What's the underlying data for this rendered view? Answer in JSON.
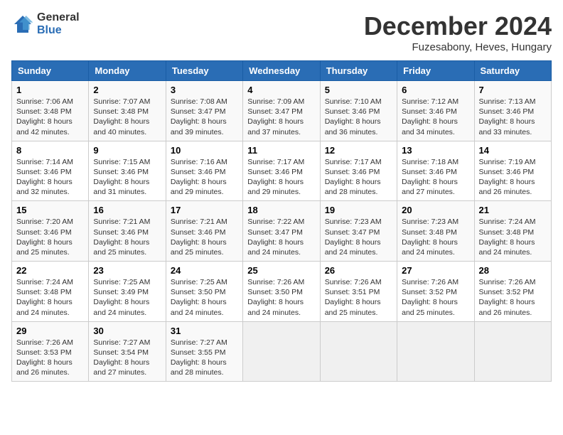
{
  "logo": {
    "general": "General",
    "blue": "Blue"
  },
  "title": "December 2024",
  "subtitle": "Fuzesabony, Heves, Hungary",
  "headers": [
    "Sunday",
    "Monday",
    "Tuesday",
    "Wednesday",
    "Thursday",
    "Friday",
    "Saturday"
  ],
  "weeks": [
    [
      {
        "day": "1",
        "sunrise": "7:06 AM",
        "sunset": "3:48 PM",
        "daylight": "8 hours and 42 minutes."
      },
      {
        "day": "2",
        "sunrise": "7:07 AM",
        "sunset": "3:48 PM",
        "daylight": "8 hours and 40 minutes."
      },
      {
        "day": "3",
        "sunrise": "7:08 AM",
        "sunset": "3:47 PM",
        "daylight": "8 hours and 39 minutes."
      },
      {
        "day": "4",
        "sunrise": "7:09 AM",
        "sunset": "3:47 PM",
        "daylight": "8 hours and 37 minutes."
      },
      {
        "day": "5",
        "sunrise": "7:10 AM",
        "sunset": "3:46 PM",
        "daylight": "8 hours and 36 minutes."
      },
      {
        "day": "6",
        "sunrise": "7:12 AM",
        "sunset": "3:46 PM",
        "daylight": "8 hours and 34 minutes."
      },
      {
        "day": "7",
        "sunrise": "7:13 AM",
        "sunset": "3:46 PM",
        "daylight": "8 hours and 33 minutes."
      }
    ],
    [
      {
        "day": "8",
        "sunrise": "7:14 AM",
        "sunset": "3:46 PM",
        "daylight": "8 hours and 32 minutes."
      },
      {
        "day": "9",
        "sunrise": "7:15 AM",
        "sunset": "3:46 PM",
        "daylight": "8 hours and 31 minutes."
      },
      {
        "day": "10",
        "sunrise": "7:16 AM",
        "sunset": "3:46 PM",
        "daylight": "8 hours and 29 minutes."
      },
      {
        "day": "11",
        "sunrise": "7:17 AM",
        "sunset": "3:46 PM",
        "daylight": "8 hours and 29 minutes."
      },
      {
        "day": "12",
        "sunrise": "7:17 AM",
        "sunset": "3:46 PM",
        "daylight": "8 hours and 28 minutes."
      },
      {
        "day": "13",
        "sunrise": "7:18 AM",
        "sunset": "3:46 PM",
        "daylight": "8 hours and 27 minutes."
      },
      {
        "day": "14",
        "sunrise": "7:19 AM",
        "sunset": "3:46 PM",
        "daylight": "8 hours and 26 minutes."
      }
    ],
    [
      {
        "day": "15",
        "sunrise": "7:20 AM",
        "sunset": "3:46 PM",
        "daylight": "8 hours and 25 minutes."
      },
      {
        "day": "16",
        "sunrise": "7:21 AM",
        "sunset": "3:46 PM",
        "daylight": "8 hours and 25 minutes."
      },
      {
        "day": "17",
        "sunrise": "7:21 AM",
        "sunset": "3:46 PM",
        "daylight": "8 hours and 25 minutes."
      },
      {
        "day": "18",
        "sunrise": "7:22 AM",
        "sunset": "3:47 PM",
        "daylight": "8 hours and 24 minutes."
      },
      {
        "day": "19",
        "sunrise": "7:23 AM",
        "sunset": "3:47 PM",
        "daylight": "8 hours and 24 minutes."
      },
      {
        "day": "20",
        "sunrise": "7:23 AM",
        "sunset": "3:48 PM",
        "daylight": "8 hours and 24 minutes."
      },
      {
        "day": "21",
        "sunrise": "7:24 AM",
        "sunset": "3:48 PM",
        "daylight": "8 hours and 24 minutes."
      }
    ],
    [
      {
        "day": "22",
        "sunrise": "7:24 AM",
        "sunset": "3:48 PM",
        "daylight": "8 hours and 24 minutes."
      },
      {
        "day": "23",
        "sunrise": "7:25 AM",
        "sunset": "3:49 PM",
        "daylight": "8 hours and 24 minutes."
      },
      {
        "day": "24",
        "sunrise": "7:25 AM",
        "sunset": "3:50 PM",
        "daylight": "8 hours and 24 minutes."
      },
      {
        "day": "25",
        "sunrise": "7:26 AM",
        "sunset": "3:50 PM",
        "daylight": "8 hours and 24 minutes."
      },
      {
        "day": "26",
        "sunrise": "7:26 AM",
        "sunset": "3:51 PM",
        "daylight": "8 hours and 25 minutes."
      },
      {
        "day": "27",
        "sunrise": "7:26 AM",
        "sunset": "3:52 PM",
        "daylight": "8 hours and 25 minutes."
      },
      {
        "day": "28",
        "sunrise": "7:26 AM",
        "sunset": "3:52 PM",
        "daylight": "8 hours and 26 minutes."
      }
    ],
    [
      {
        "day": "29",
        "sunrise": "7:26 AM",
        "sunset": "3:53 PM",
        "daylight": "8 hours and 26 minutes."
      },
      {
        "day": "30",
        "sunrise": "7:27 AM",
        "sunset": "3:54 PM",
        "daylight": "8 hours and 27 minutes."
      },
      {
        "day": "31",
        "sunrise": "7:27 AM",
        "sunset": "3:55 PM",
        "daylight": "8 hours and 28 minutes."
      },
      null,
      null,
      null,
      null
    ]
  ]
}
